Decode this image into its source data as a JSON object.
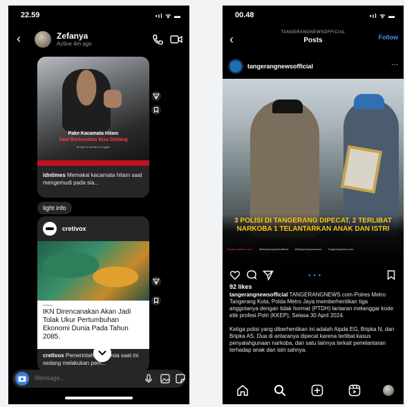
{
  "left": {
    "status": {
      "time": "22.59",
      "signal": "•ıl ᯤ ▬"
    },
    "header": {
      "back": "‹",
      "name": "Zefanya",
      "presence": "Active 4m ago"
    },
    "card1": {
      "image_title": "Pake Kacamata Hitam",
      "image_subtitle": "Saat Berkendara Bisa Ditilang",
      "image_foot": "Aturan ini berlaku di Inggris",
      "caption_user": "idntimes",
      "caption_text": " Memakai kacamata hitam saat mengemudi pada sia..."
    },
    "bubble": "light info",
    "card2": {
      "account": "cretivox",
      "article_source": "cretivox",
      "article_title": "IKN Direncanakan Akan Jadi Tolak Ukur Pertumbuhan Ekonomi Dunia Pada Tahun 2085.",
      "caption_user": "cretivox",
      "caption_text": " Pemerintah Indonesia saat ini sedang melakukan pem..."
    },
    "composer": {
      "placeholder": "Message..."
    }
  },
  "right": {
    "status": {
      "time": "00.48",
      "signal": "•ıl ᯤ ▬"
    },
    "header": {
      "back": "‹",
      "handle": "TANGERANGNEWSOFFICIAL",
      "title": "Posts",
      "follow": "Follow"
    },
    "account": {
      "name": "tangerangnewsofficial",
      "more": "···"
    },
    "image": {
      "headline": "3 Polisi di Tangerang Dipecat, 2 Terlibat Narkoba 1 Telantarkan Anak dan Istri",
      "stripe": [
        "TangerangNews.com",
        "@tangerangnewsofficial",
        "@tangerangnewscom",
        "Tangerangnews.com"
      ]
    },
    "likes": "92 likes",
    "caption": {
      "user": "tangerangnewsofficial",
      "p1": " TANGERANGNEWS.com-Polres Metro Tangerang Kota, Polda Metro Jaya memberhentikan tiga anggotanya dengan tidak hormat (PTDH) lantaran melanggar kode etik profesi Polri (KKEP), Selasa 30 April 2024.",
      "p2": "Ketiga polisi yang diberhentikan ini adalah Aipda EG, Bripka N, dan Bripka AS. Dua di antaranya dipecat karena terlibat kasus penyalahgunaan narkoba, dan satu lainnya terkait penelantaran terhadap anak dan istri sahnya."
    }
  }
}
